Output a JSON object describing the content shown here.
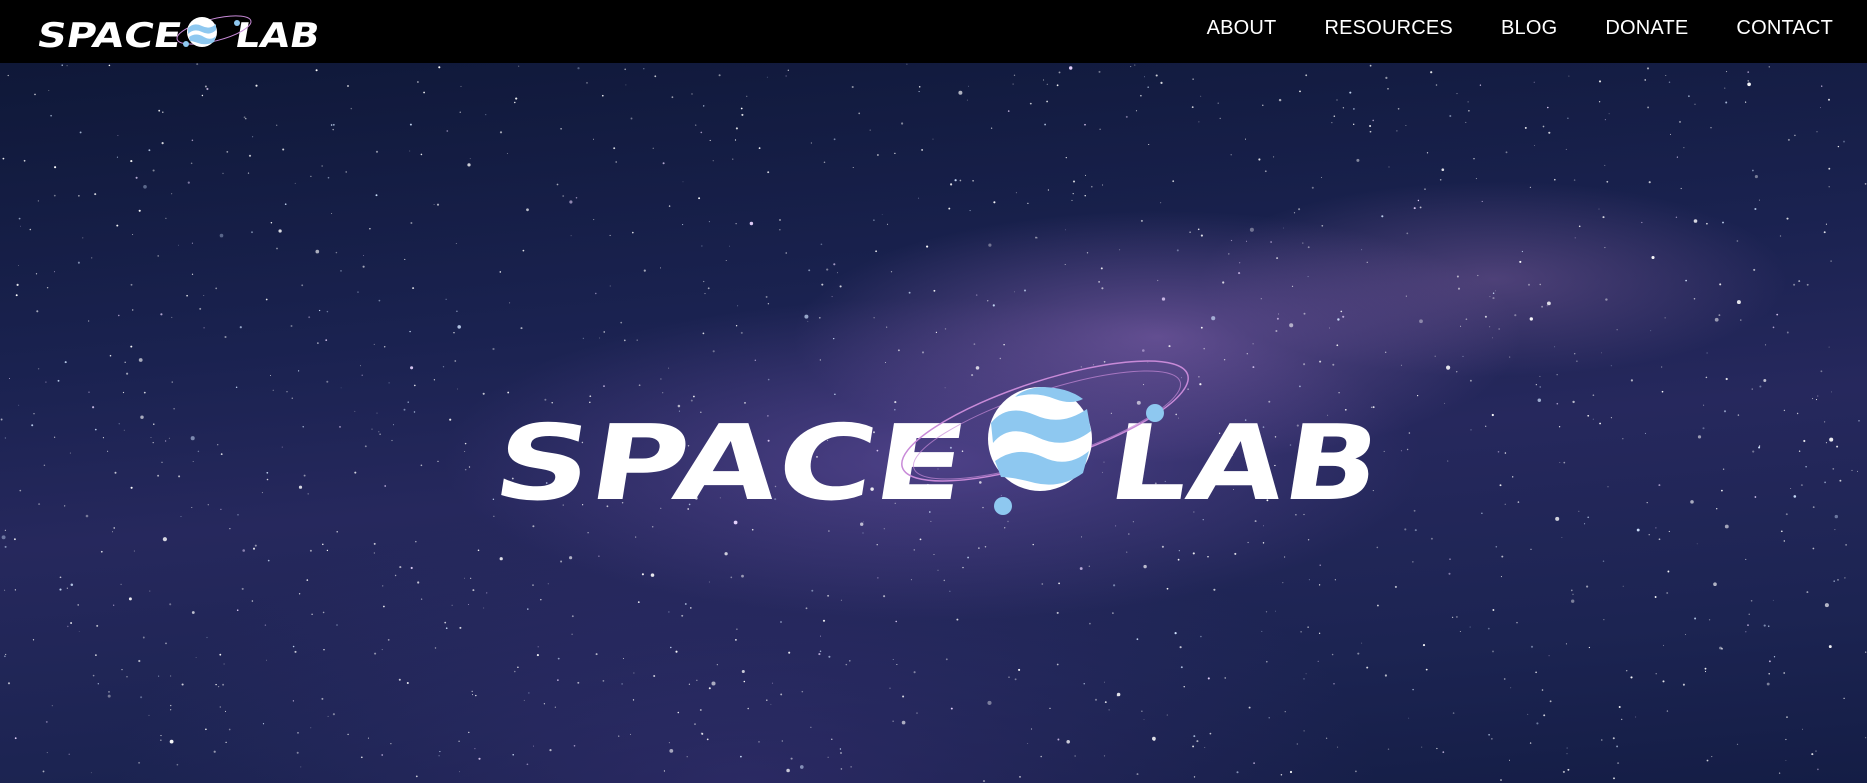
{
  "brand": {
    "name": "SPACE LAB",
    "word_left": "SPACE",
    "word_right": "LAB",
    "logo_icon": "planet-icon",
    "colors": {
      "text": "#ffffff",
      "planet_fill": "#8ec8f0",
      "orbit": "#c88ad8"
    }
  },
  "nav": {
    "items": [
      {
        "label": "ABOUT"
      },
      {
        "label": "RESOURCES"
      },
      {
        "label": "BLOG"
      },
      {
        "label": "DONATE"
      },
      {
        "label": "CONTACT"
      }
    ]
  },
  "hero": {
    "background": "starfield-milky-way",
    "logo_word_left": "SPACE",
    "logo_word_right": "LAB"
  },
  "theme": {
    "nav_bg": "#000000",
    "nav_text": "#ffffff",
    "sky_dark": "#141d45",
    "sky_glow": "#9a78c2"
  }
}
